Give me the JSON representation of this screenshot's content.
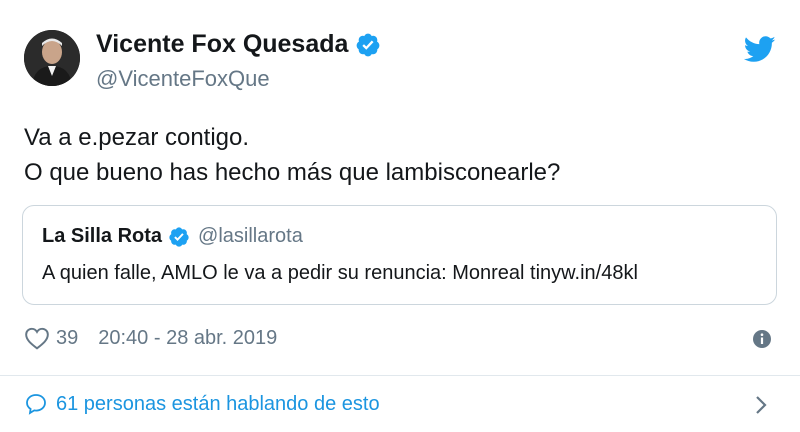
{
  "author": {
    "name": "Vicente Fox Quesada",
    "handle": "@VicenteFoxQue",
    "verified": true
  },
  "tweet": {
    "lines": [
      "Va a e.pezar contigo.",
      "O que bueno has hecho más que lambisconearle?"
    ]
  },
  "quoted": {
    "name": "La Silla Rota",
    "handle": "@lasillarota",
    "text": "A quien falle, AMLO le va a pedir su renuncia: Monreal tinyw.in/48kl",
    "verified": true
  },
  "meta": {
    "likes": "39",
    "timestamp": "20:40 - 28 abr. 2019"
  },
  "conversation": {
    "label": "61 personas están hablando de esto"
  },
  "colors": {
    "twitter_blue": "#1da1f2",
    "link_blue": "#1b95e0",
    "secondary_text": "#657786",
    "border": "#ccd6dd"
  }
}
